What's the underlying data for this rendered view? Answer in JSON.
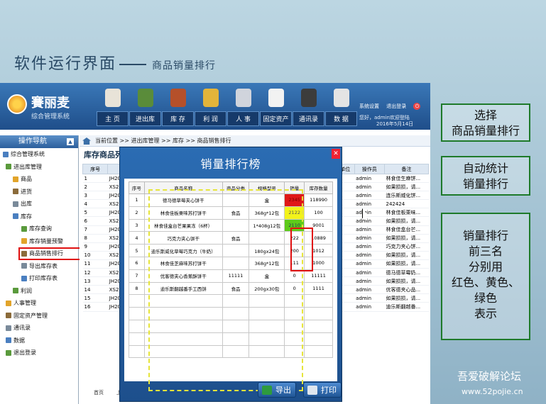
{
  "slide": {
    "title": "软件运行界面",
    "subtitle": "商品销量排行"
  },
  "app": {
    "brand_name": "賽丽麦",
    "brand_sub": "综合管理系统",
    "nav": [
      {
        "label": "主 页",
        "icon": "house-icon",
        "color": "#e8e3d8"
      },
      {
        "label": "进出库",
        "icon": "cart-icon",
        "color": "#5a8c3a"
      },
      {
        "label": "库 存",
        "icon": "box-icon",
        "color": "#b5502a"
      },
      {
        "label": "利 润",
        "icon": "coins-icon",
        "color": "#e3b43a"
      },
      {
        "label": "人 事",
        "icon": "person-icon",
        "color": "#d0d4dc"
      },
      {
        "label": "固定资产",
        "icon": "printer-icon",
        "color": "#f2f2f2"
      },
      {
        "label": "通讯录",
        "icon": "phonebook-icon",
        "color": "#3c3c3c"
      },
      {
        "label": "数 据",
        "icon": "database-icon",
        "color": "#e4e4e4"
      }
    ],
    "header_links": {
      "settings": "系统设置",
      "logout": "退出登录"
    },
    "welcome": "您好，admin欢迎登陆",
    "date": "2016年5月14日",
    "sidebar": {
      "title": "操作导航",
      "items": [
        {
          "label": "综合管理系统",
          "level": 0
        },
        {
          "label": "进出库管理",
          "level": 1
        },
        {
          "label": "商品",
          "level": 2
        },
        {
          "label": "进货",
          "level": 2
        },
        {
          "label": "出库",
          "level": 2
        },
        {
          "label": "库存",
          "level": 2
        },
        {
          "label": "库存查询",
          "level": 3
        },
        {
          "label": "库存销量预警",
          "level": 3
        },
        {
          "label": "商品销售排行",
          "level": 3,
          "highlight": true
        },
        {
          "label": "导出库存表",
          "level": 3
        },
        {
          "label": "打印库存表",
          "level": 3
        },
        {
          "label": "利润",
          "level": 2
        },
        {
          "label": "人事管理",
          "level": 1
        },
        {
          "label": "固定资产管理",
          "level": 1
        },
        {
          "label": "通讯录",
          "level": 1
        },
        {
          "label": "数据",
          "level": 1
        },
        {
          "label": "退出登录",
          "level": 1
        }
      ]
    },
    "breadcrumb": "当前位置 >> 进出库管理 >> 库存 >> 商品销售排行",
    "list_title": "库存商品列表",
    "bg_table": {
      "headers": [
        "序号",
        "单",
        "",
        "",
        "",
        "",
        "库存数量",
        "单位",
        "操作员",
        "备注"
      ],
      "rows": [
        [
          "1",
          "JH20160",
          "",
          "",
          "",
          "",
          "1111",
          "包",
          "admin",
          "林食佳生麻饼..."
        ],
        [
          "2",
          "XS20160",
          "",
          "",
          "",
          "",
          "1000",
          "包",
          "admin",
          "如果损损，请..."
        ],
        [
          "3",
          "JH20160",
          "",
          "",
          "",
          "",
          "1212",
          "包",
          "admin",
          "连乐斯威化饼..."
        ],
        [
          "4",
          "XS20160",
          "",
          "",
          "",
          "",
          "1012",
          "包",
          "admin",
          "242424"
        ],
        [
          "5",
          "JH20160",
          "",
          "",
          "",
          "",
          "2222",
          "包",
          "admin",
          "林食佳板栗味..."
        ],
        [
          "6",
          "XS20160",
          "",
          "",
          "",
          "",
          "11111",
          "盒",
          "admin",
          "如果损损，请..."
        ],
        [
          "7",
          "JH20160",
          "",
          "",
          "",
          "",
          "1111",
          "包",
          "admin",
          "林食佳盒台芒..."
        ],
        [
          "8",
          "XS20160",
          "",
          "",
          "",
          "",
          "10000",
          "包",
          "admin",
          "如果损损，请..."
        ],
        [
          "9",
          "JH20160",
          "",
          "",
          "",
          "",
          "11111",
          "包",
          "admin",
          "巧克力夹心饼..."
        ],
        [
          "10",
          "XS20160",
          "",
          "",
          "",
          "",
          "10889",
          "包",
          "admin",
          "如果损损，请..."
        ],
        [
          "11",
          "JH20160",
          "",
          "",
          "",
          "",
          "11111",
          "盒",
          "admin",
          "如果损损，请..."
        ],
        [
          "12",
          "XS20160",
          "",
          "",
          "",
          "",
          "121212",
          "包",
          "admin",
          "德马德草霉奶..."
        ],
        [
          "13",
          "JH20160",
          "",
          "",
          "",
          "",
          "118990",
          "盒",
          "admin",
          "如果损损，请..."
        ],
        [
          "14",
          "XS20160",
          "",
          "",
          "",
          "",
          "1000",
          "包",
          "admin",
          "优客德夹心品..."
        ],
        [
          "15",
          "JH20160",
          "",
          "",
          "",
          "",
          "11111",
          "包",
          "admin",
          "如果损损，请..."
        ],
        [
          "16",
          "JH20160",
          "",
          "",
          "",
          "",
          "1000",
          "包",
          "admin",
          "迪乐斯翻越番..."
        ]
      ]
    },
    "pager": {
      "first": "首页",
      "prev": "上"
    }
  },
  "modal": {
    "title": "销量排行榜",
    "headers": [
      "序号",
      "商品名称",
      "商品分类",
      "规格型号",
      "销量",
      "库存数量"
    ],
    "rows": [
      {
        "no": "1",
        "name": "德马德草莓夹心饼干",
        "category": "",
        "spec": "盒",
        "qty": "2345",
        "stock": "118990",
        "rank_color": "red"
      },
      {
        "no": "2",
        "name": "林食佳板栗味苏打饼干",
        "category": "食品",
        "spec": "368g*12包",
        "qty": "2122",
        "stock": "100",
        "rank_color": "yellow"
      },
      {
        "no": "3",
        "name": "林食佳盒台芒果果冻（6杯）",
        "category": "",
        "spec": "1*408g12包",
        "qty": "2110",
        "stock": "9001",
        "rank_color": "green"
      },
      {
        "no": "4",
        "name": "巧克力夹心饼干",
        "category": "食品",
        "spec": "",
        "qty": "222",
        "stock": "10889",
        "rank_color": ""
      },
      {
        "no": "5",
        "name": "迪乐斯威化草莓巧克力（牛奶）",
        "category": "",
        "spec": "180gx24包",
        "qty": "200",
        "stock": "1012",
        "rank_color": ""
      },
      {
        "no": "6",
        "name": "林食佳芝麻味苏打饼干",
        "category": "",
        "spec": "368g*12包",
        "qty": "111",
        "stock": "1000",
        "rank_color": ""
      },
      {
        "no": "7",
        "name": "优客德夹心香蕉酥饼干",
        "category": "11111",
        "spec": "盒",
        "qty": "0",
        "stock": "11111",
        "rank_color": ""
      },
      {
        "no": "8",
        "name": "迪乐斯翻越番手工西饼",
        "category": "食品",
        "spec": "200gx30包",
        "qty": "0",
        "stock": "1111",
        "rank_color": ""
      }
    ],
    "export_label": "导出",
    "print_label": "打印"
  },
  "annotations": [
    {
      "text": "选择\n商品销量排行"
    },
    {
      "text": "自动统计\n销量排行"
    },
    {
      "text": "销量排行\n前三名\n分别用\n红色、黄色、\n绿色\n表示"
    }
  ],
  "watermark": {
    "text": "吾爱破解论坛",
    "url": "www.52pojie.cn"
  }
}
